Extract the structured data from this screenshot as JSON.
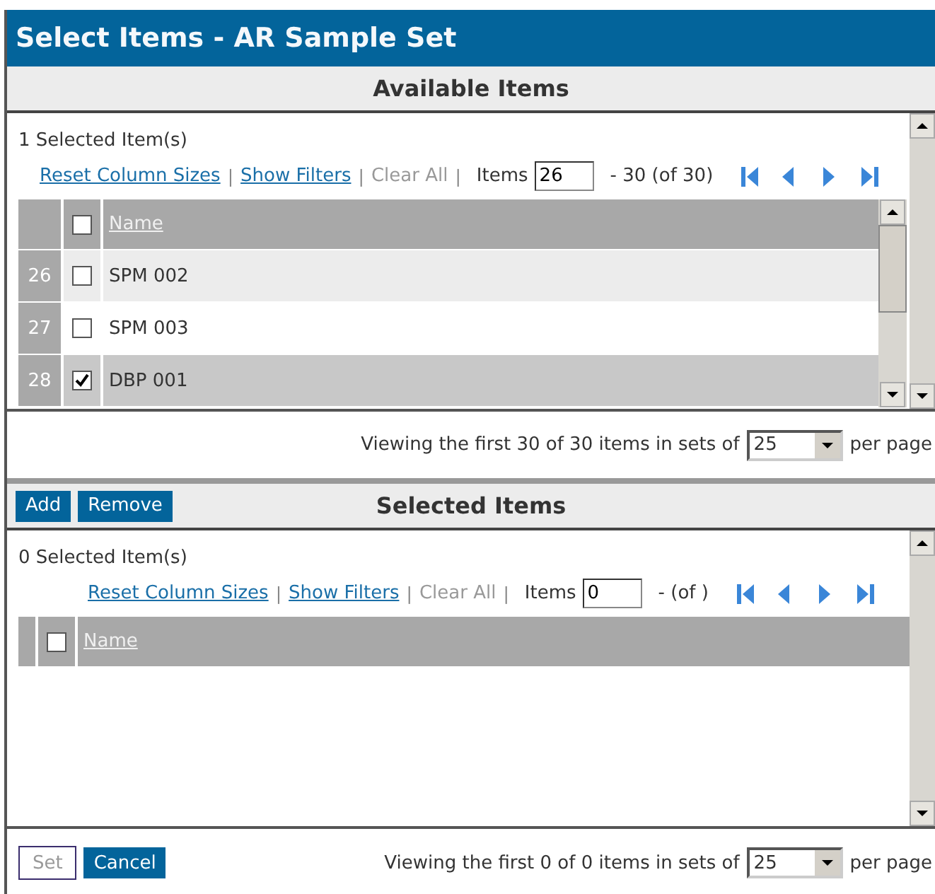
{
  "window": {
    "title": "Select Items - AR Sample Set"
  },
  "available": {
    "heading": "Available Items",
    "count": "1  Selected Item(s)",
    "links": [
      "Reset Column Sizes",
      "Show Filters"
    ],
    "clear": "Clear All",
    "items_label": "Items",
    "items_value": "26",
    "range": "- 30 (of 30)",
    "column": "Name",
    "header_checked": false,
    "separator": "|",
    "rows": [
      {
        "number": "26",
        "name": "SPM 002",
        "checked": false,
        "selected": false
      },
      {
        "number": "27",
        "name": "SPM 003",
        "checked": false,
        "selected": false
      },
      {
        "number": "28",
        "name": "DBP 001",
        "checked": true,
        "selected": true
      }
    ],
    "footer": "Viewing the first 30 of 30 items in sets of",
    "page_size": "25",
    "suffix": "per page"
  },
  "actions": [
    "Add",
    "Remove"
  ],
  "selected": {
    "heading": "Selected Items",
    "count": "0  Selected Item(s)",
    "links": [
      "Reset Column Sizes",
      "Show Filters"
    ],
    "clear": "Clear All",
    "items_label": "Items",
    "items_value": "0",
    "range": "-  (of )",
    "column": "Name",
    "header_checked": false,
    "separator": "|",
    "footer": "Viewing the first 0 of 0 items in sets of",
    "page_size": "25",
    "suffix": "per page"
  },
  "buttons": [
    {
      "label": "Set",
      "disabled": true
    },
    {
      "label": "Cancel",
      "disabled": false
    }
  ]
}
